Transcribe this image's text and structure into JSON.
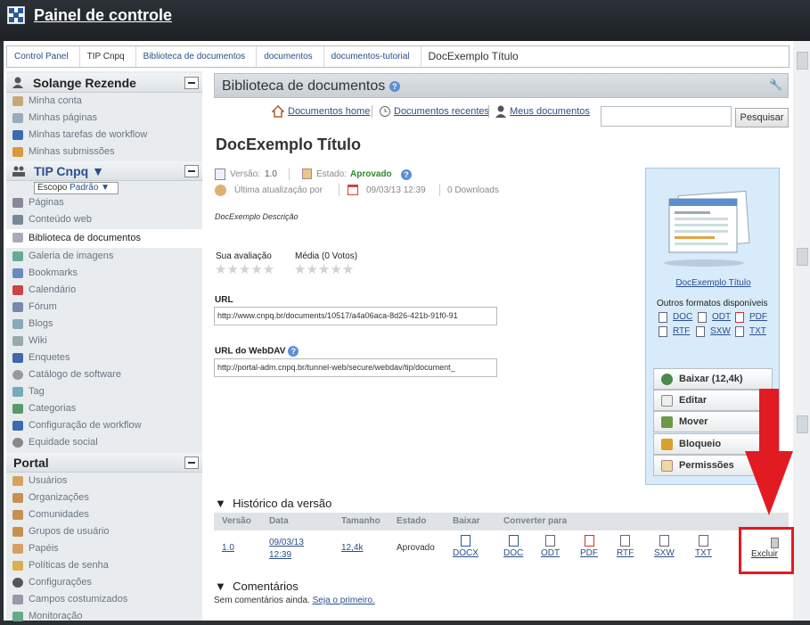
{
  "app": {
    "title": "Painel de controle"
  },
  "breadcrumb": [
    "Control Panel",
    "TIP Cnpq",
    "Biblioteca de documentos",
    "documentos",
    "documentos-tutorial",
    "DocExemplo Título"
  ],
  "sidebar": {
    "user_name": "Solange Rezende",
    "user_items": [
      "Minha conta",
      "Minhas páginas",
      "Minhas tarefas de workflow",
      "Minhas submissões"
    ],
    "site_name": "TIP Cnpq ▼",
    "scope_label": "Escopo",
    "scope_value": "Padrão ▼",
    "site_items": [
      "Páginas",
      "Conteúdo web",
      "Biblioteca de documentos",
      "Galeria de imagens",
      "Bookmarks",
      "Calendário",
      "Fórum",
      "Blogs",
      "Wiki",
      "Enquetes",
      "Catálogo de software",
      "Tag",
      "Categorias",
      "Configuração de workflow",
      "Equidade social"
    ],
    "portal_title": "Portal",
    "portal_items": [
      "Usuários",
      "Organizações",
      "Comunidades",
      "Grupos de usuário",
      "Papéis",
      "Políticas de senha",
      "Configurações",
      "Campos costumizados",
      "Monitoração"
    ]
  },
  "portlet": {
    "title": "Biblioteca de documentos",
    "help": "?"
  },
  "toolbar": {
    "home": "Documentos home",
    "recent": "Documentos recentes",
    "mine": "Meus documentos",
    "search_button": "Pesquisar",
    "search_value": ""
  },
  "document": {
    "title": "DocExemplo Título",
    "version_label": "Versão:",
    "version": "1.0",
    "status_label": "Estado:",
    "status": "Aprovado",
    "updated_by": "Última atualização por",
    "date": "09/03/13 12:39",
    "downloads": "0 Downloads",
    "description": "DocExemplo Descrição",
    "your_rating": "Sua avaliação",
    "average": "Média (0 Votos)",
    "url_label": "URL",
    "url": "http://www.cnpq.br/documents/10517/a4a06aca-8d26-421b-91f0-91",
    "webdav_label": "URL do WebDAV",
    "webdav": "http://portal-adm.cnpq.br/tunnel-web/secure/webdav/tip/document_"
  },
  "panel": {
    "doc_link": "DocExemplo Título",
    "formats_title": "Outros formatos disponíveis",
    "formats": [
      "DOC",
      "ODT",
      "PDF",
      "RTF",
      "SXW",
      "TXT"
    ],
    "actions": [
      "Baixar (12,4k)",
      "Editar",
      "Mover",
      "Bloqueio",
      "Permissões"
    ]
  },
  "history": {
    "title": "Histórico da versão",
    "columns": [
      "Versão",
      "Data",
      "Tamanho",
      "Estado",
      "Baixar",
      "Converter para"
    ],
    "row": {
      "version": "1.0",
      "date1": "09/03/13",
      "date2": "12:39",
      "size": "12,4k",
      "status": "Aprovado",
      "download": "DOCX"
    },
    "convert": [
      "DOC",
      "ODT",
      "PDF",
      "RTF",
      "SXW",
      "TXT"
    ],
    "delete": "Excluir"
  },
  "comments": {
    "title": "Comentários",
    "empty": "Sem comentários ainda.",
    "first": "Seja o primeiro."
  },
  "colors": {
    "annotation": "#e21b22",
    "approved": "#2a8a2a",
    "link": "#2a4f8a"
  }
}
